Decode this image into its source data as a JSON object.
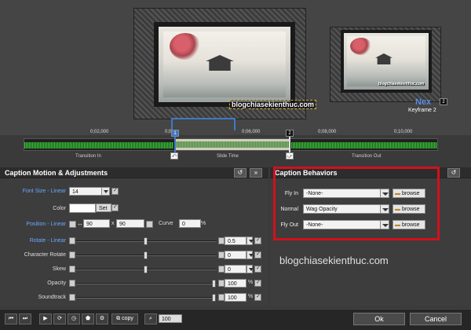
{
  "preview": {
    "overlay_caption": "blogchiasekienthuc.com",
    "next_label": "Nex",
    "next_badge": "2",
    "keyframe_label": "Keyframe 2",
    "next_watermark": "blogchiasekienthuc.com"
  },
  "timeline": {
    "ticks": [
      "0;02,000",
      "0;0",
      "0;06,000",
      "0;08,000",
      "0;10,000"
    ],
    "start_badge": "1",
    "end_badge": "2",
    "labels": {
      "transition_in": "Transition In",
      "slide_time": "Slide Time",
      "transition_out": "Transition Out"
    }
  },
  "motion": {
    "title": "Caption Motion & Adjustments",
    "font_size_label": "Font Size - Linear",
    "font_size_value": "14",
    "color_label": "Color",
    "color_set_label": "Set",
    "position_label": "Position - Linear",
    "position_x": "90",
    "position_sep": "x",
    "position_y": "90",
    "curve_label": "Curve",
    "curve_value": "0",
    "curve_unit": "%",
    "sliders": [
      {
        "label": "Rotate - Linear",
        "value": "0.5",
        "level": 0.5,
        "highlight": true
      },
      {
        "label": "Character Rotate",
        "value": "0",
        "level": 0.5,
        "highlight": false
      },
      {
        "label": "Skew",
        "value": "0",
        "level": 0.5,
        "highlight": false
      },
      {
        "label": "Opacity",
        "value": "100",
        "unit": "%",
        "level": 1.0,
        "highlight": false
      },
      {
        "label": "Soundtrack",
        "value": "100",
        "unit": "%",
        "level": 1.0,
        "highlight": false
      }
    ]
  },
  "behaviors": {
    "title": "Caption Behaviors",
    "rows": [
      {
        "label": "Fly In",
        "value": "-None-",
        "button": "browse"
      },
      {
        "label": "Normal",
        "value": "Wag Opacity",
        "button": "browse"
      },
      {
        "label": "Fly Out",
        "value": "-None-",
        "button": "browse"
      }
    ]
  },
  "watermark": "blogchiasekienthuc.com",
  "toolbar": {
    "copy_label": "copy",
    "zoom_value": "100",
    "ok_label": "Ok",
    "cancel_label": "Cancel"
  },
  "colors": {
    "accent_blue": "#6aa8ff",
    "highlight_red": "#d2111b",
    "wave_green": "#3dbb3d"
  }
}
